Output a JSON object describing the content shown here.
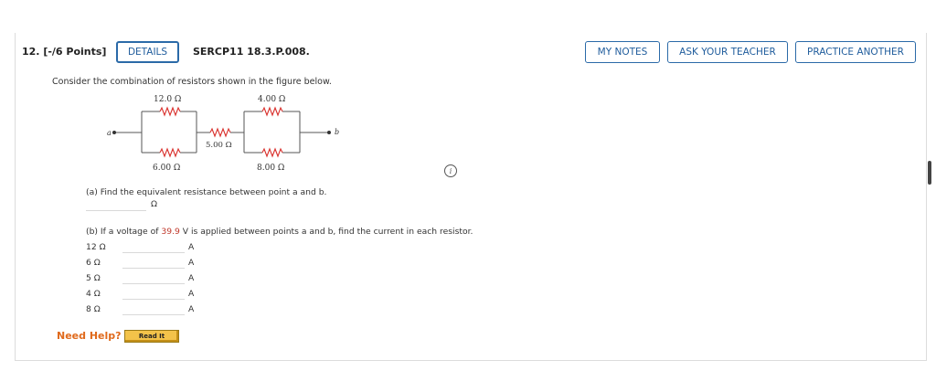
{
  "header": {
    "question_number": "12. [-/6 Points]",
    "details_label": "DETAILS",
    "problem_code": "SERCP11 18.3.P.008.",
    "my_notes_label": "MY NOTES",
    "ask_teacher_label": "ASK YOUR TEACHER",
    "practice_another_label": "PRACTICE ANOTHER"
  },
  "problem": {
    "prompt": "Consider the combination of resistors shown in the figure below.",
    "figure": {
      "r12": "12.0 Ω",
      "r4": "4.00 Ω",
      "r5": "5.00 Ω",
      "r6": "6.00 Ω",
      "r8": "8.00 Ω",
      "point_a": "a",
      "point_b": "b"
    },
    "info_icon": "info-icon",
    "part_a": "(a) Find the equivalent resistance between point a and b.",
    "part_a_unit": "Ω",
    "part_b_prefix": "(b) If a voltage of ",
    "part_b_voltage": "39.9",
    "part_b_suffix": " V is applied between points a and b, find the current in each resistor.",
    "resistors": [
      {
        "label": "12 Ω",
        "unit": "A"
      },
      {
        "label": "6 Ω",
        "unit": "A"
      },
      {
        "label": "5 Ω",
        "unit": "A"
      },
      {
        "label": "4 Ω",
        "unit": "A"
      },
      {
        "label": "8 Ω",
        "unit": "A"
      }
    ]
  },
  "help": {
    "need_help_label": "Need Help?",
    "read_it_label": "Read It"
  },
  "colors": {
    "accent_blue": "#1f5c9c",
    "resistor_red": "#d9302c",
    "voltage_red": "#c0392b",
    "help_orange": "#e06a1c",
    "read_it_yellow": "#f3c34a"
  }
}
